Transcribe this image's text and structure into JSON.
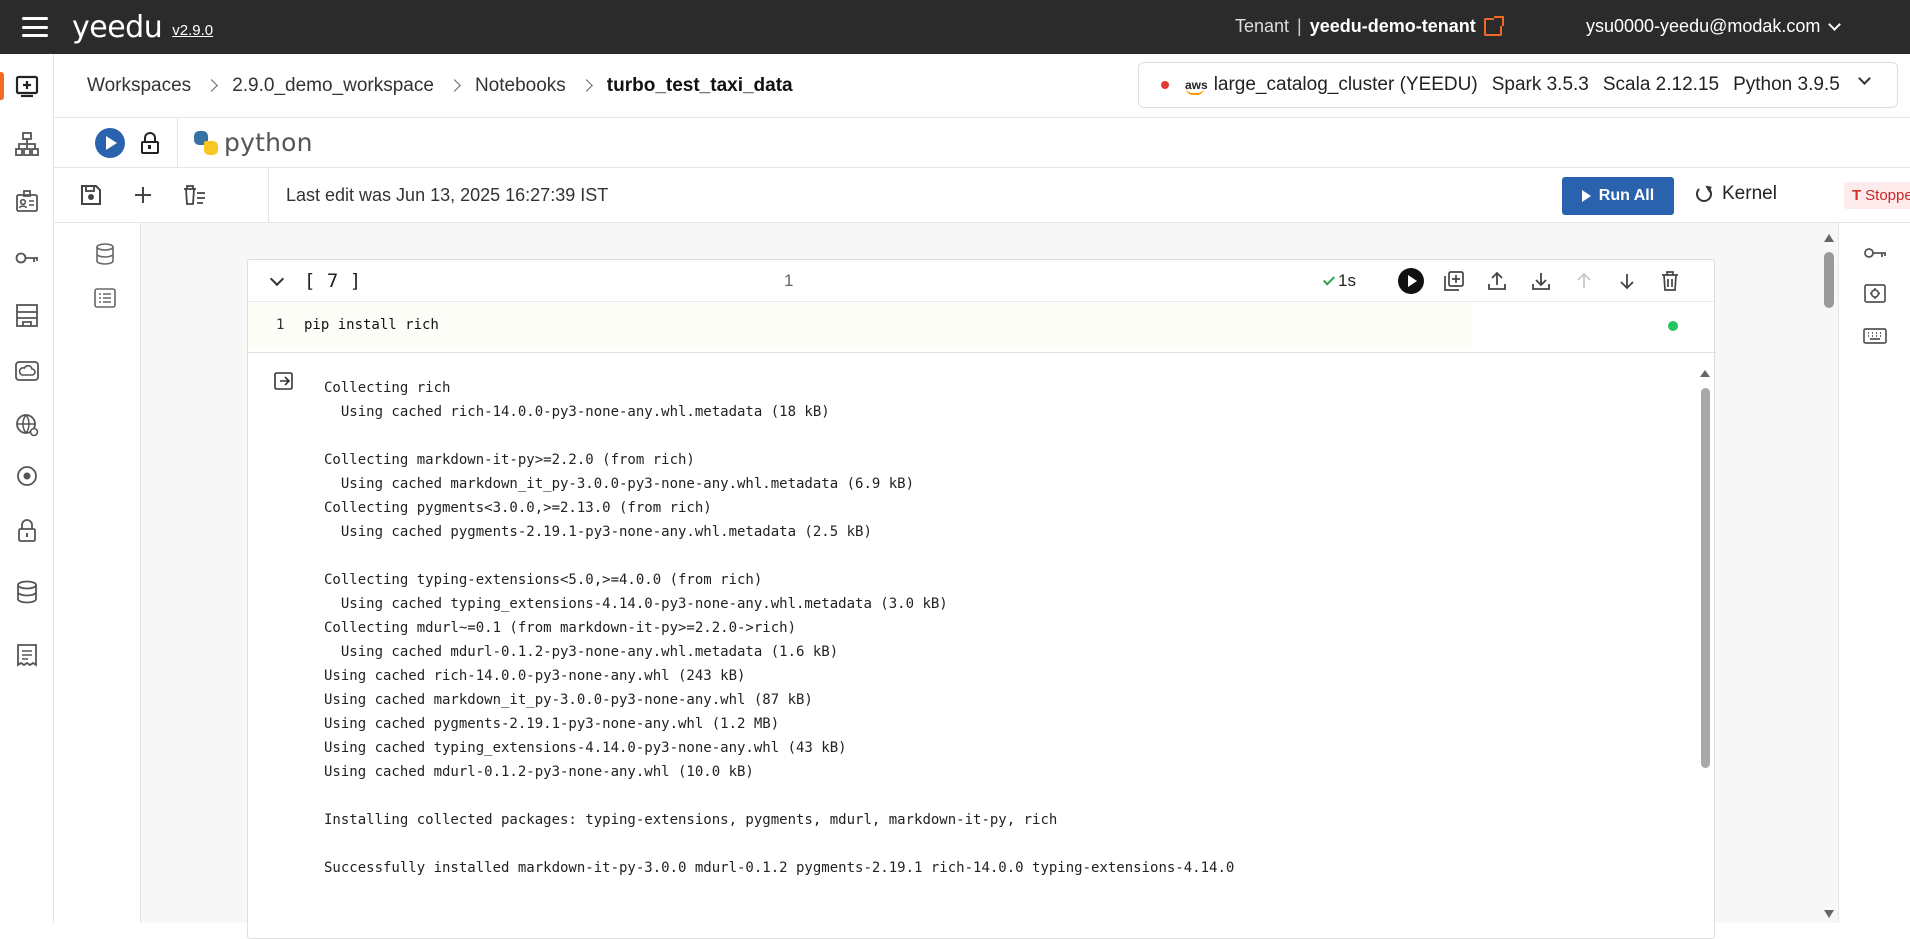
{
  "app": {
    "logo_text": "yeedu",
    "version": "v2.9.0",
    "tenant_label": "Tenant",
    "tenant_sep": "|",
    "tenant_name": "yeedu-demo-tenant",
    "user_email": "ysu0000-yeedu@modak.com"
  },
  "breadcrumb": {
    "items": [
      "Workspaces",
      "2.9.0_demo_workspace",
      "Notebooks",
      "turbo_test_taxi_data"
    ]
  },
  "cluster": {
    "provider": "aws",
    "name": "large_catalog_cluster (YEEDU)",
    "spark": "Spark 3.5.3",
    "scala": "Scala 2.12.15",
    "python": "Python 3.9.5",
    "status_color": "#e53935"
  },
  "language": {
    "name": "python"
  },
  "toolbar": {
    "last_edit": "Last edit was Jun 13, 2025 16:27:39 IST",
    "run_all": "Run All",
    "kernel": "Kernel",
    "kernel_status": "Stopped"
  },
  "cell": {
    "exec_label": "[ 7 ]",
    "line_count": "1",
    "duration": "1s",
    "code_line_no": "1",
    "code": "pip install rich",
    "output_lines": [
      "Collecting rich",
      "  Using cached rich-14.0.0-py3-none-any.whl.metadata (18 kB)",
      "",
      "Collecting markdown-it-py>=2.2.0 (from rich)",
      "  Using cached markdown_it_py-3.0.0-py3-none-any.whl.metadata (6.9 kB)",
      "Collecting pygments<3.0.0,>=2.13.0 (from rich)",
      "  Using cached pygments-2.19.1-py3-none-any.whl.metadata (2.5 kB)",
      "",
      "Collecting typing-extensions<5.0,>=4.0.0 (from rich)",
      "  Using cached typing_extensions-4.14.0-py3-none-any.whl.metadata (3.0 kB)",
      "Collecting mdurl~=0.1 (from markdown-it-py>=2.2.0->rich)",
      "  Using cached mdurl-0.1.2-py3-none-any.whl.metadata (1.6 kB)",
      "Using cached rich-14.0.0-py3-none-any.whl (243 kB)",
      "Using cached markdown_it_py-3.0.0-py3-none-any.whl (87 kB)",
      "Using cached pygments-2.19.1-py3-none-any.whl (1.2 MB)",
      "Using cached typing_extensions-4.14.0-py3-none-any.whl (43 kB)",
      "Using cached mdurl-0.1.2-py3-none-any.whl (10.0 kB)",
      "",
      "Installing collected packages: typing-extensions, pygments, mdurl, markdown-it-py, rich",
      "",
      "Successfully installed markdown-it-py-3.0.0 mdurl-0.1.2 pygments-2.19.1 rich-14.0.0 typing-extensions-4.14.0"
    ]
  },
  "sidebar": {
    "items": [
      "notebook-add-icon",
      "sitemap-icon",
      "contact-card-icon",
      "key-icon",
      "building-icon",
      "cloud-box-icon",
      "globe-settings-icon",
      "target-icon",
      "lock-icon",
      "database-icon",
      "receipt-icon"
    ]
  },
  "colors": {
    "topbar": "#2b2b2b",
    "accent": "#f26a21",
    "primary": "#2a62ad",
    "success": "#22c55e"
  }
}
